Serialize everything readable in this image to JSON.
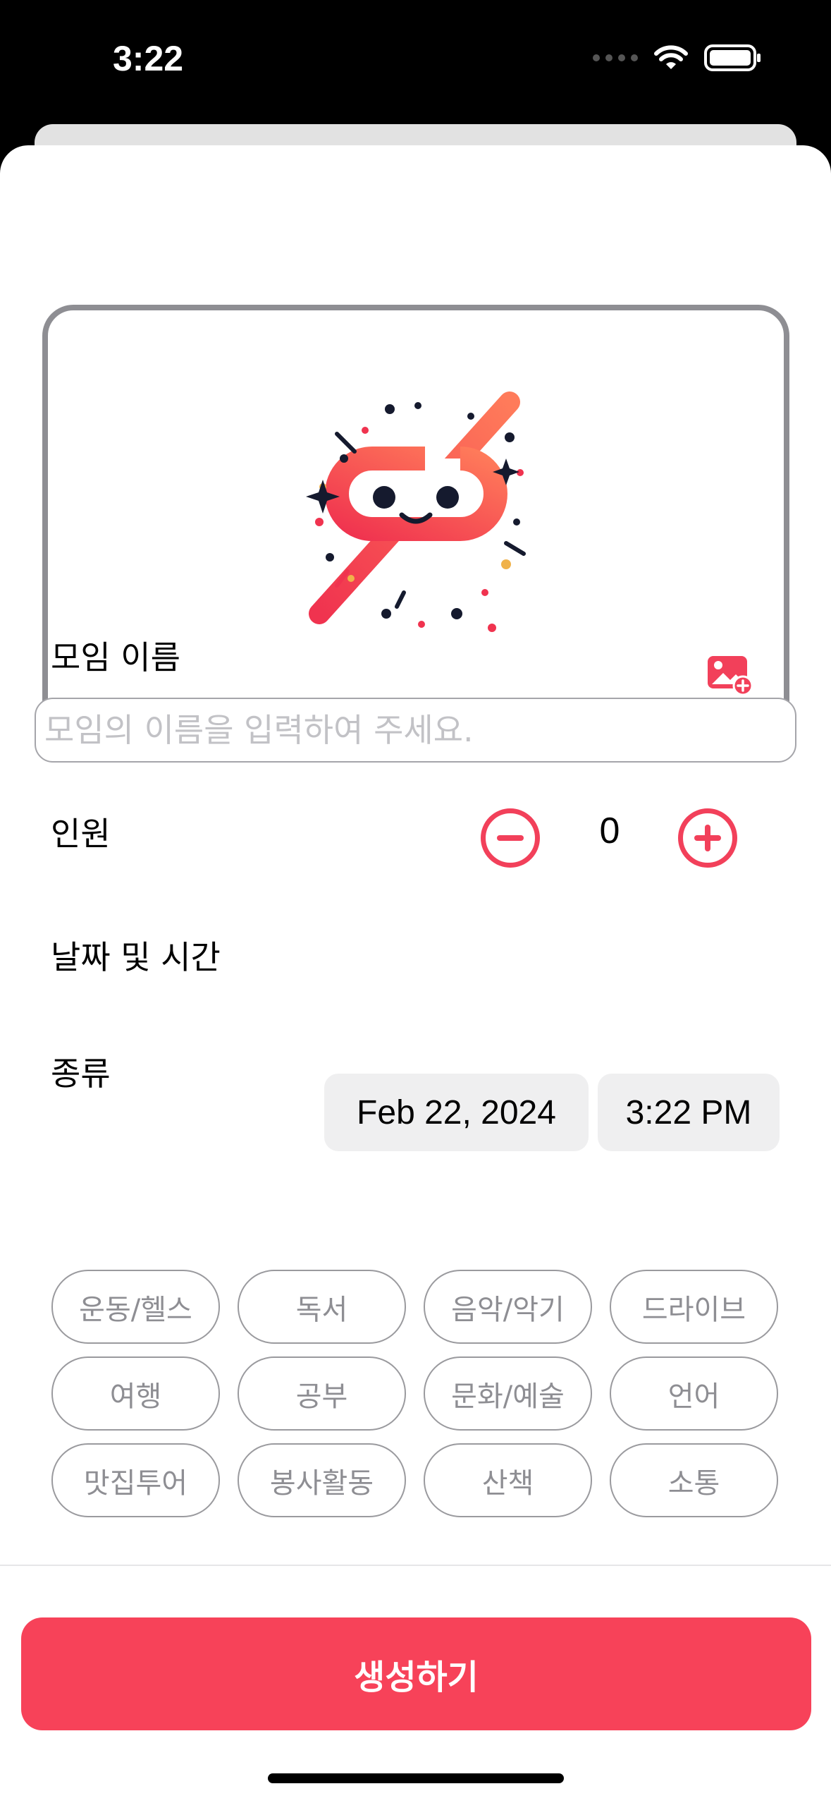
{
  "status_bar": {
    "time": "3:22"
  },
  "form": {
    "name_label": "모임 이름",
    "name_placeholder": "모임의 이름을 입력하여 주세요.",
    "name_value": "",
    "capacity_label": "인원",
    "capacity_value": "0",
    "datetime_label": "날짜 및 시간",
    "date_value": "Feb 22, 2024",
    "time_value": "3:22 PM",
    "category_label": "종류",
    "categories": [
      "운동/헬스",
      "독서",
      "음악/악기",
      "드라이브",
      "여행",
      "공부",
      "문화/예술",
      "언어",
      "맛집투어",
      "봉사활동",
      "산책",
      "소통"
    ]
  },
  "actions": {
    "create_label": "생성하기"
  },
  "colors": {
    "accent": "#f2405a",
    "button": "#f74259",
    "border": "#8e8e93"
  },
  "icons": {
    "add_photo": "add-photo-icon",
    "minus": "minus-circle-icon",
    "plus": "plus-circle-icon",
    "wifi": "wifi-icon",
    "battery": "battery-icon"
  }
}
